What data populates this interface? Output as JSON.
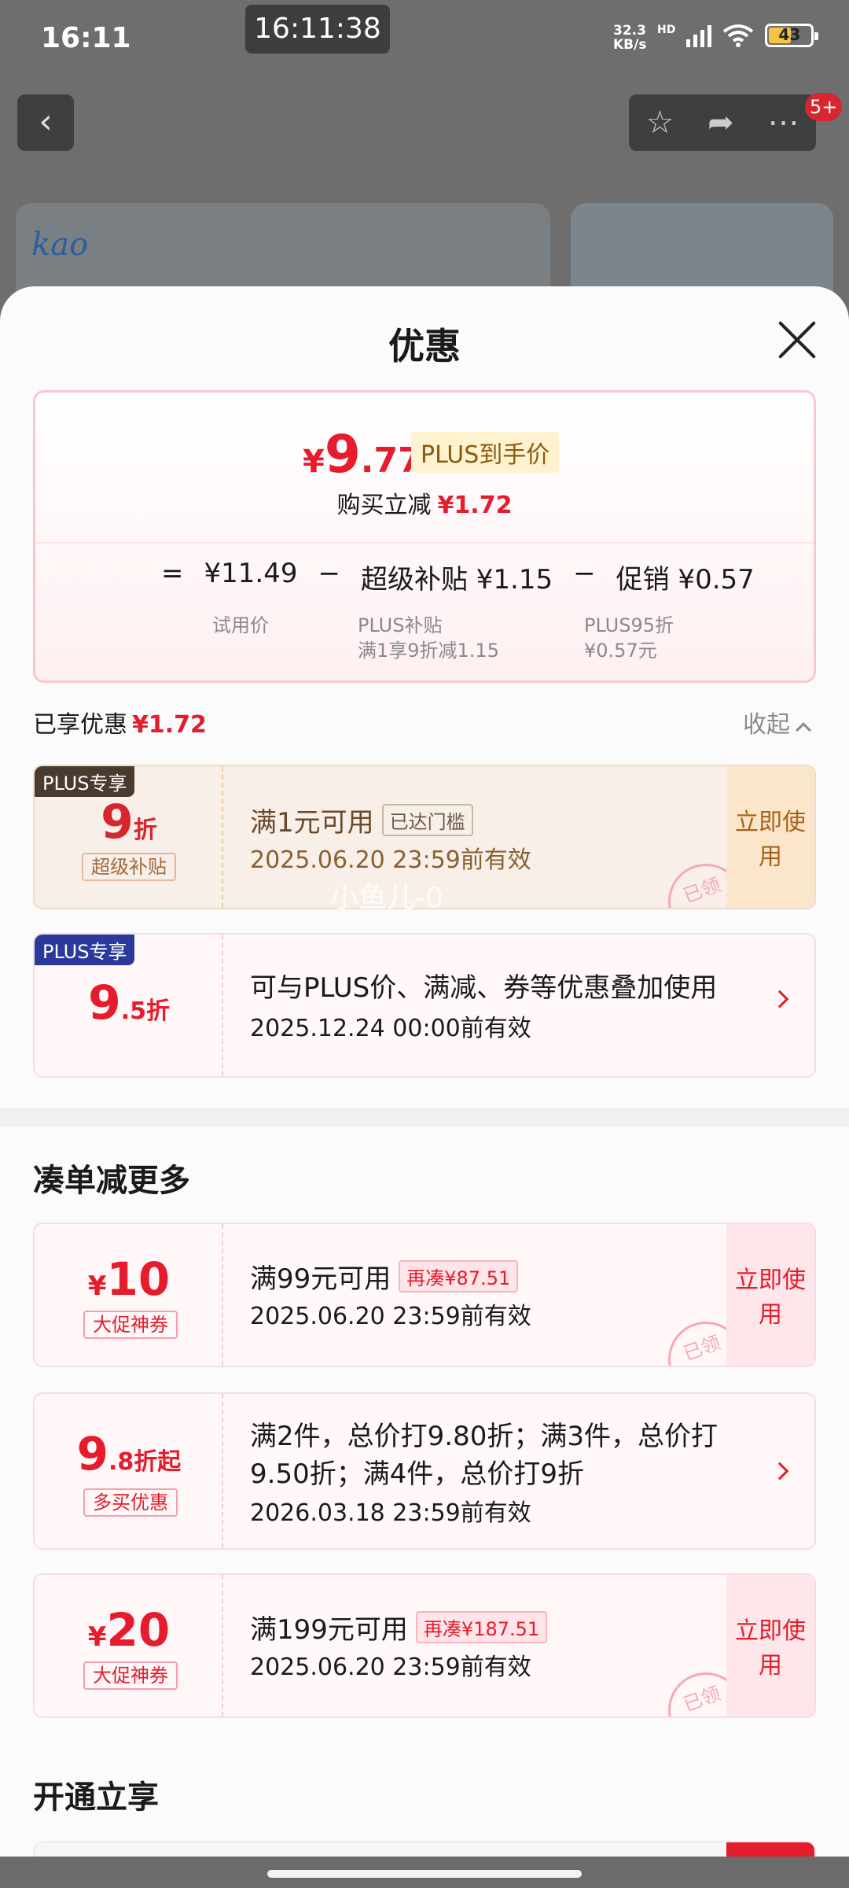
{
  "status": {
    "time": "16:11",
    "clock": "16:11:38",
    "speed": "32.3",
    "speed_unit": "KB/s",
    "network": "HD",
    "network2": "6",
    "battery": "43"
  },
  "nav": {
    "badge": "5+"
  },
  "banner": {
    "brand": "kao"
  },
  "sheet": {
    "title": "优惠",
    "summary": {
      "currency": "¥",
      "price_int": "9",
      "price_dec": ".77",
      "plus_tag": "PLUS到手价",
      "reduce_label": "购买立减",
      "reduce_value": "¥1.72",
      "formula": {
        "eq": "=",
        "trial_price": "¥11.49",
        "minus": "−",
        "super": "超级补贴 ¥1.15",
        "promo": "促销 ¥0.57",
        "trial_sub": "试用价",
        "super_sub1": "PLUS补贴",
        "super_sub2": "满1享9折减1.15",
        "promo_sub1": "PLUS95折",
        "promo_sub2": "¥0.57元"
      }
    },
    "enjoyed": {
      "label": "已享优惠",
      "value": "¥1.72",
      "collapse": "收起"
    },
    "watermark": "小鱼儿-0",
    "coupons": [
      {
        "tag": "PLUS专享",
        "big_int": "9",
        "big_suffix": "折",
        "tagbox": "超级补贴",
        "line1": "满1元可用",
        "mini": "已达门槛",
        "line2": "2025.06.20 23:59前有效",
        "btn": "立即使用",
        "stamp": "已领"
      },
      {
        "tag": "PLUS专享",
        "big_int": "9",
        "big_dec": ".5",
        "big_suffix": "折",
        "line1": "可与PLUS价、满减、券等优惠叠加使用",
        "line2": "2025.12.24 00:00前有效"
      }
    ],
    "more_title": "凑单减更多",
    "more": [
      {
        "cur": "¥",
        "big_int": "10",
        "tagbox": "大促神券",
        "line1": "满99元可用",
        "mini": "再凑¥87.51",
        "line2": "2025.06.20 23:59前有效",
        "btn": "立即使用",
        "stamp": "已领"
      },
      {
        "big_int": "9",
        "big_dec": ".8",
        "big_suffix": "折起",
        "tagbox": "多买优惠",
        "line1a": "满2件，总价打9.80折；满3件，总价打",
        "line1b": "9.50折；满4件，总价打9折",
        "line2": "2026.03.18 23:59前有效"
      },
      {
        "cur": "¥",
        "big_int": "20",
        "tagbox": "大促神券",
        "line1": "满199元可用",
        "mini": "再凑¥187.51",
        "line2": "2025.06.20 23:59前有效",
        "btn": "立即使用",
        "stamp": "已领"
      }
    ],
    "open_title": "开通立享"
  }
}
